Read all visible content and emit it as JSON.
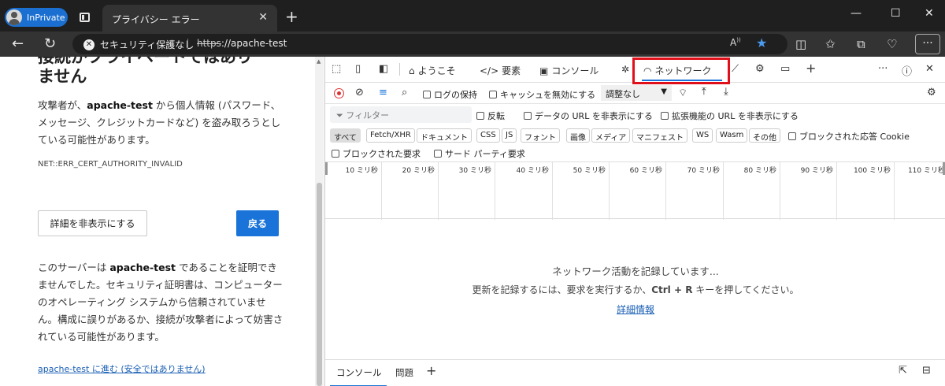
{
  "browser": {
    "profile_label": "InPrivate",
    "tab_title": "プライバシー エラー",
    "address": {
      "security_label": "セキュリティ保護なし",
      "scheme": "https",
      "rest": "://apache-test"
    },
    "accent": "#1a73d8"
  },
  "page": {
    "heading_line1": "接続がプライベートではあり",
    "heading_line2": "ません",
    "para1_prefix": "攻撃者が、",
    "para1_host": "apache-test",
    "para1_suffix": " から個人情報 (パスワード、メッセージ、クレジットカードなど) を盗み取ろうとしている可能性があります。",
    "error_code": "NET::ERR_CERT_AUTHORITY_INVALID",
    "hide_details_button": "詳細を非表示にする",
    "back_button": "戻る",
    "para2_prefix": "このサーバーは ",
    "para2_host": "apache-test",
    "para2_suffix": " であることを証明できませんでした。セキュリティ証明書は、コンピューターのオペレーティング システムから信頼されていません。構成に誤りがあるか、接続が攻撃者によって妨害されている可能性があります。",
    "proceed_link": "apache-test に進む (安全ではありません)"
  },
  "devtools": {
    "tabs": {
      "welcome": "ようこそ",
      "elements": "要素",
      "console": "コンソール",
      "network": "ネットワーク"
    },
    "toolbar": {
      "preserve_log": "ログの保持",
      "disable_cache": "キャッシュを無効にする",
      "throttle": "調整なし"
    },
    "filter": {
      "placeholder": "フィルター",
      "invert": "反転",
      "hide_data_urls": "データの URL を非表示にする",
      "hide_extension_urls": "拡張機能の URL を非表示にする"
    },
    "types": [
      "すべて",
      "Fetch/XHR",
      "ドキュメント",
      "CSS",
      "JS",
      "フォント",
      "画像",
      "メディア",
      "マニフェスト",
      "WS",
      "Wasm",
      "その他"
    ],
    "blocked_cookies": "ブロックされた応答 Cookie",
    "blocked_requests": "ブロックされた要求",
    "third_party": "サード パーティ要求",
    "timeline_ticks": [
      "10 ミリ秒",
      "20 ミリ秒",
      "30 ミリ秒",
      "40 ミリ秒",
      "50 ミリ秒",
      "60 ミリ秒",
      "70 ミリ秒",
      "80 ミリ秒",
      "90 ミリ秒",
      "100 ミリ秒",
      "110 ミリ秒"
    ],
    "empty": {
      "line1": "ネットワーク活動を記録しています...",
      "line2_prefix": "更新を記録するには、要求を実行するか、",
      "line2_keys": "Ctrl + R",
      "line2_suffix": " キーを押してください。",
      "learn_more": "詳細情報"
    },
    "drawer": {
      "console": "コンソール",
      "issues": "問題"
    }
  }
}
